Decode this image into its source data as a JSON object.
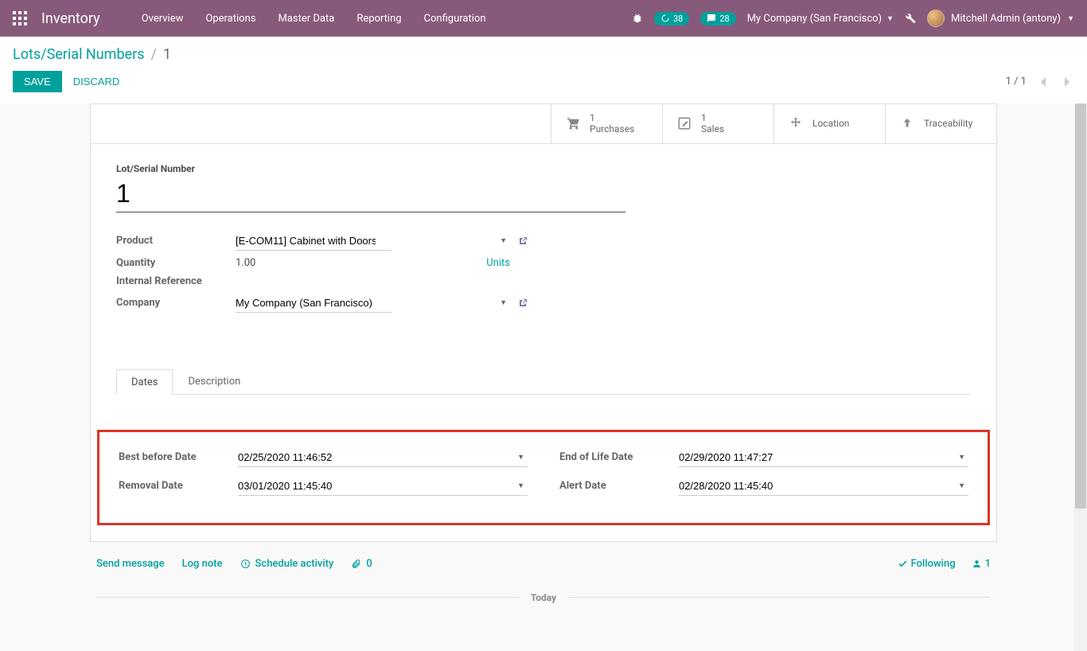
{
  "navbar": {
    "brand": "Inventory",
    "menu": [
      "Overview",
      "Operations",
      "Master Data",
      "Reporting",
      "Configuration"
    ],
    "notif_badge": "38",
    "chat_badge": "28",
    "company": "My Company (San Francisco)",
    "user": "Mitchell Admin (antony)"
  },
  "breadcrumb": {
    "parent": "Lots/Serial Numbers",
    "current": "1"
  },
  "buttons": {
    "save": "Save",
    "discard": "Discard"
  },
  "pager": {
    "text": "1 / 1"
  },
  "stats": {
    "purchases": {
      "count": "1",
      "label": "Purchases"
    },
    "sales": {
      "count": "1",
      "label": "Sales"
    },
    "location": "Location",
    "trace": "Traceability"
  },
  "form": {
    "title_label": "Lot/Serial Number",
    "title_value": "1",
    "labels": {
      "product": "Product",
      "quantity": "Quantity",
      "intref": "Internal Reference",
      "company": "Company"
    },
    "product": "[E-COM11] Cabinet with Doors",
    "quantity": "1.00",
    "quantity_unit": "Units",
    "company": "My Company (San Francisco)"
  },
  "tabs": {
    "dates": "Dates",
    "description": "Description"
  },
  "dates": {
    "labels": {
      "best_before": "Best before Date",
      "removal": "Removal Date",
      "eol": "End of Life Date",
      "alert": "Alert Date"
    },
    "best_before": "02/25/2020 11:46:52",
    "removal": "03/01/2020 11:45:40",
    "eol": "02/29/2020 11:47:27",
    "alert": "02/28/2020 11:45:40"
  },
  "chatter": {
    "send": "Send message",
    "log": "Log note",
    "schedule": "Schedule activity",
    "attach_count": "0",
    "following": "Following",
    "followers": "1",
    "today": "Today"
  }
}
